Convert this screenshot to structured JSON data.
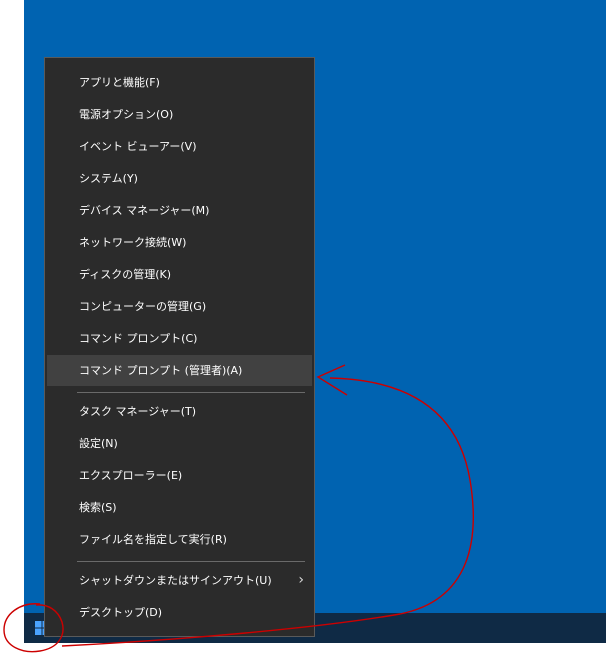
{
  "menu": {
    "items": [
      {
        "label": "アプリと機能(F)"
      },
      {
        "label": "電源オプション(O)"
      },
      {
        "label": "イベント ビューアー(V)"
      },
      {
        "label": "システム(Y)"
      },
      {
        "label": "デバイス マネージャー(M)"
      },
      {
        "label": "ネットワーク接続(W)"
      },
      {
        "label": "ディスクの管理(K)"
      },
      {
        "label": "コンピューターの管理(G)"
      },
      {
        "label": "コマンド プロンプト(C)"
      },
      {
        "label": "コマンド プロンプト (管理者)(A)",
        "highlighted": true
      },
      {
        "label": "タスク マネージャー(T)"
      },
      {
        "label": "設定(N)"
      },
      {
        "label": "エクスプローラー(E)"
      },
      {
        "label": "検索(S)"
      },
      {
        "label": "ファイル名を指定して実行(R)"
      },
      {
        "label": "シャットダウンまたはサインアウト(U)",
        "has_submenu": true
      },
      {
        "label": "デスクトップ(D)"
      }
    ]
  },
  "colors": {
    "desktop": "#0063b1",
    "taskbar": "#0f2a45",
    "menu_bg": "#2b2b2b",
    "menu_highlight": "#414141",
    "annotation": "#cc0000"
  },
  "icons": {
    "start": "windows-logo-icon",
    "submenu": "chevron-right-icon"
  }
}
